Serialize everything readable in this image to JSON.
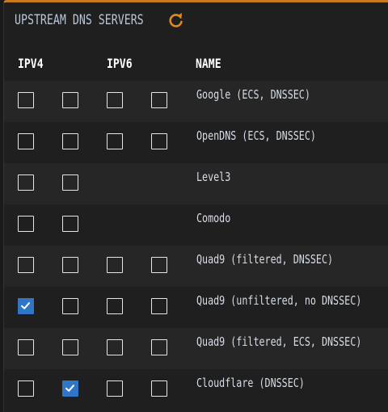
{
  "header": {
    "title": "UPSTREAM DNS SERVERS",
    "refresh_icon": "refresh-icon",
    "accent": "#c97a1f"
  },
  "columns": {
    "ipv4": "IPV4",
    "ipv6": "IPV6",
    "name": "NAME"
  },
  "servers": [
    {
      "name": "Google (ECS, DNSSEC)",
      "checks": [
        false,
        false,
        false,
        false
      ]
    },
    {
      "name": "OpenDNS (ECS, DNSSEC)",
      "checks": [
        false,
        false,
        false,
        false
      ]
    },
    {
      "name": "Level3",
      "checks": [
        false,
        false,
        null,
        null
      ]
    },
    {
      "name": "Comodo",
      "checks": [
        false,
        false,
        null,
        null
      ]
    },
    {
      "name": "Quad9 (filtered, DNSSEC)",
      "checks": [
        false,
        false,
        false,
        false
      ]
    },
    {
      "name": "Quad9 (unfiltered, no DNSSEC)",
      "checks": [
        true,
        false,
        false,
        false
      ]
    },
    {
      "name": "Quad9 (filtered, ECS, DNSSEC)",
      "checks": [
        false,
        false,
        false,
        false
      ]
    },
    {
      "name": "Cloudflare (DNSSEC)",
      "checks": [
        false,
        true,
        false,
        false
      ]
    }
  ],
  "colors": {
    "checked": "#2f77c6",
    "title": "#b8c7d8"
  }
}
